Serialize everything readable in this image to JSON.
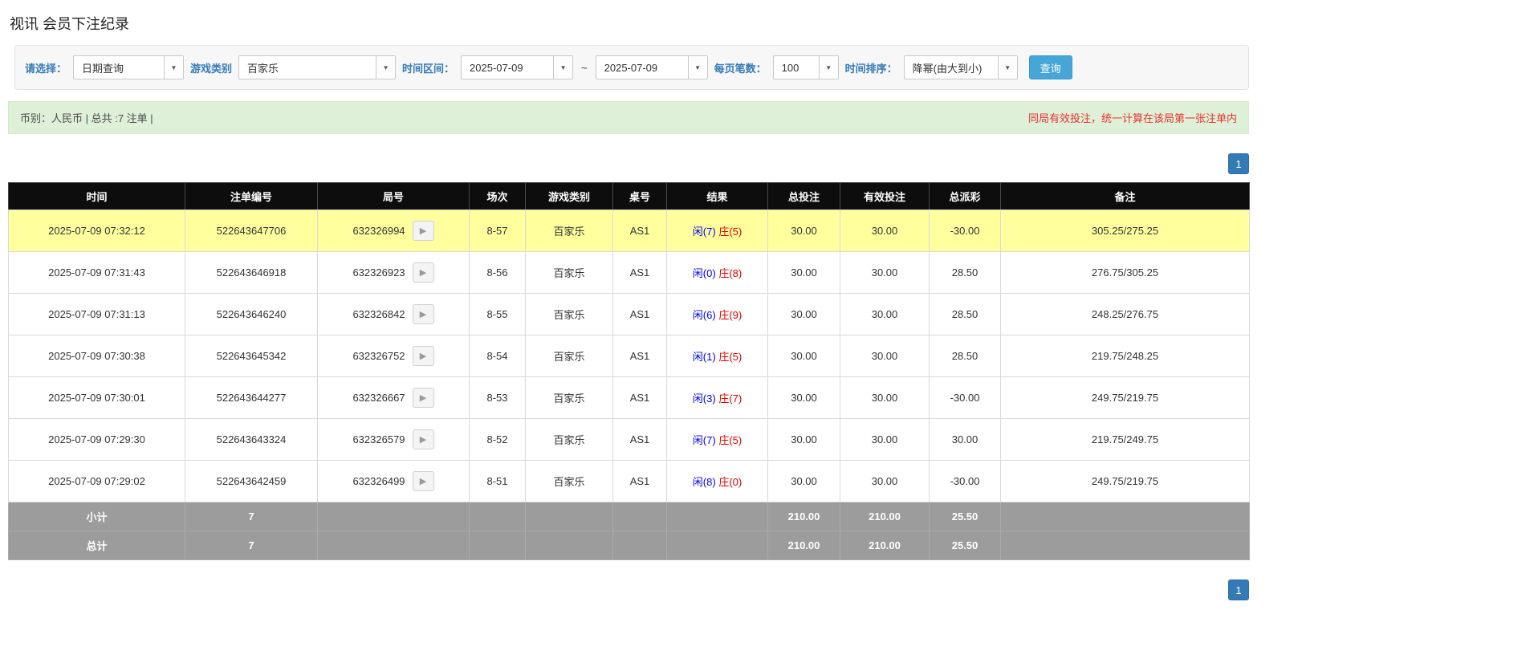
{
  "page": {
    "title": "视讯 会员下注纪录"
  },
  "icons": {
    "caret": "▼",
    "video_play": "▶"
  },
  "colors": {
    "filter_label_blue": "#337ab7",
    "search_button_blue": "#46a6d8",
    "pager_blue": "#337ab7",
    "summary_bg_green": "#dff0d8",
    "summary_note_red": "#e53333",
    "header_bg": "#0d0d0d",
    "highlight_row_yellow": "#ffff9e",
    "player_blue": "#0000ee",
    "banker_red": "#e60000",
    "total_bet_blue": "#337ab7",
    "negative_red": "#e60000",
    "footer_gray": "#9c9c9c"
  },
  "filters": {
    "select_label": "请选择：",
    "select_value": "日期查询",
    "game_type_label": "游戏类别",
    "game_type_value": "百家乐",
    "date_range_label": "时间区间：",
    "date_from": "2025-07-09",
    "date_separator": "~",
    "date_to": "2025-07-09",
    "page_size_label": "每页笔数：",
    "page_size_value": "100",
    "sort_label": "时间排序：",
    "sort_value": "降幂(由大到小)",
    "search_button": "查询"
  },
  "summary": {
    "left_text": "币别：人民币 | 总共 :7 注单 |",
    "right_note": "同局有效投注，统一计算在该局第一张注单内"
  },
  "pagination": {
    "page": "1"
  },
  "table": {
    "headers": [
      "时间",
      "注单编号",
      "局号",
      "场次",
      "游戏类别",
      "桌号",
      "结果",
      "总投注",
      "有效投注",
      "总派彩",
      "备注"
    ],
    "rows": [
      {
        "time": "2025-07-09 07:32:12",
        "bet_id": "522643647706",
        "round_id": "632326994",
        "session": "8-57",
        "game_type": "百家乐",
        "table_no": "AS1",
        "result_player": "闲(7)",
        "result_banker": "庄(5)",
        "total_bet": "30.00",
        "valid_bet": "30.00",
        "payout": "-30.00",
        "note": "305.25/275.25",
        "highlighted": true
      },
      {
        "time": "2025-07-09 07:31:43",
        "bet_id": "522643646918",
        "round_id": "632326923",
        "session": "8-56",
        "game_type": "百家乐",
        "table_no": "AS1",
        "result_player": "闲(0)",
        "result_banker": "庄(8)",
        "total_bet": "30.00",
        "valid_bet": "30.00",
        "payout": "28.50",
        "note": "276.75/305.25",
        "highlighted": false
      },
      {
        "time": "2025-07-09 07:31:13",
        "bet_id": "522643646240",
        "round_id": "632326842",
        "session": "8-55",
        "game_type": "百家乐",
        "table_no": "AS1",
        "result_player": "闲(6)",
        "result_banker": "庄(9)",
        "total_bet": "30.00",
        "valid_bet": "30.00",
        "payout": "28.50",
        "note": "248.25/276.75",
        "highlighted": false
      },
      {
        "time": "2025-07-09 07:30:38",
        "bet_id": "522643645342",
        "round_id": "632326752",
        "session": "8-54",
        "game_type": "百家乐",
        "table_no": "AS1",
        "result_player": "闲(1)",
        "result_banker": "庄(5)",
        "total_bet": "30.00",
        "valid_bet": "30.00",
        "payout": "28.50",
        "note": "219.75/248.25",
        "highlighted": false
      },
      {
        "time": "2025-07-09 07:30:01",
        "bet_id": "522643644277",
        "round_id": "632326667",
        "session": "8-53",
        "game_type": "百家乐",
        "table_no": "AS1",
        "result_player": "闲(3)",
        "result_banker": "庄(7)",
        "total_bet": "30.00",
        "valid_bet": "30.00",
        "payout": "-30.00",
        "note": "249.75/219.75",
        "highlighted": false
      },
      {
        "time": "2025-07-09 07:29:30",
        "bet_id": "522643643324",
        "round_id": "632326579",
        "session": "8-52",
        "game_type": "百家乐",
        "table_no": "AS1",
        "result_player": "闲(7)",
        "result_banker": "庄(5)",
        "total_bet": "30.00",
        "valid_bet": "30.00",
        "payout": "30.00",
        "note": "219.75/249.75",
        "highlighted": false
      },
      {
        "time": "2025-07-09 07:29:02",
        "bet_id": "522643642459",
        "round_id": "632326499",
        "session": "8-51",
        "game_type": "百家乐",
        "table_no": "AS1",
        "result_player": "闲(8)",
        "result_banker": "庄(0)",
        "total_bet": "30.00",
        "valid_bet": "30.00",
        "payout": "-30.00",
        "note": "249.75/219.75",
        "highlighted": false
      }
    ],
    "footer_rows": [
      {
        "label": "小计",
        "count": "7",
        "total_bet": "210.00",
        "valid_bet": "210.00",
        "payout": "25.50"
      },
      {
        "label": "总计",
        "count": "7",
        "total_bet": "210.00",
        "valid_bet": "210.00",
        "payout": "25.50"
      }
    ]
  }
}
